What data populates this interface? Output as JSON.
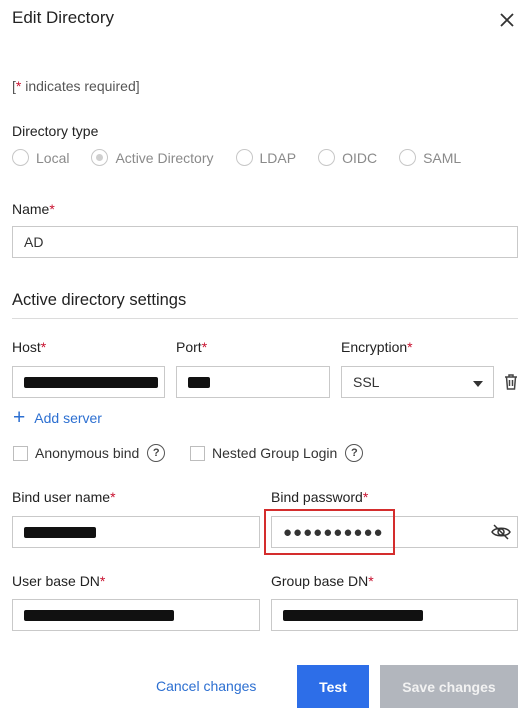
{
  "dialog": {
    "title": "Edit Directory",
    "required_note_prefix": "[",
    "required_note_star": "*",
    "required_note_text": " indicates required]"
  },
  "directory_type": {
    "label": "Directory type",
    "options": [
      "Local",
      "Active Directory",
      "LDAP",
      "OIDC",
      "SAML"
    ],
    "selected": "Active Directory"
  },
  "name": {
    "label": "Name",
    "value": "AD"
  },
  "ad_settings": {
    "title": "Active directory settings"
  },
  "server": {
    "host_label": "Host",
    "port_label": "Port",
    "encryption_label": "Encryption",
    "encryption_value": "SSL",
    "add_server_label": "Add server"
  },
  "options": {
    "anonymous_bind": "Anonymous bind",
    "nested_group_login": "Nested Group Login",
    "help_glyph": "?"
  },
  "bind": {
    "user_label": "Bind user name",
    "password_label": "Bind password",
    "password_value": "●●●●●●●●●●"
  },
  "base_dn": {
    "user_label": "User base DN",
    "group_label": "Group base DN"
  },
  "footer": {
    "cancel": "Cancel changes",
    "test": "Test",
    "save": "Save changes"
  },
  "required_star": "*",
  "colors": {
    "accent": "#2d6ee8",
    "required": "#c8102e",
    "highlight": "#d42d2d",
    "disabled": "#b2b6bd"
  },
  "icons": [
    "close-icon",
    "plus-icon",
    "trash-icon",
    "chevron-down-icon",
    "help-icon",
    "eye-off-icon"
  ]
}
